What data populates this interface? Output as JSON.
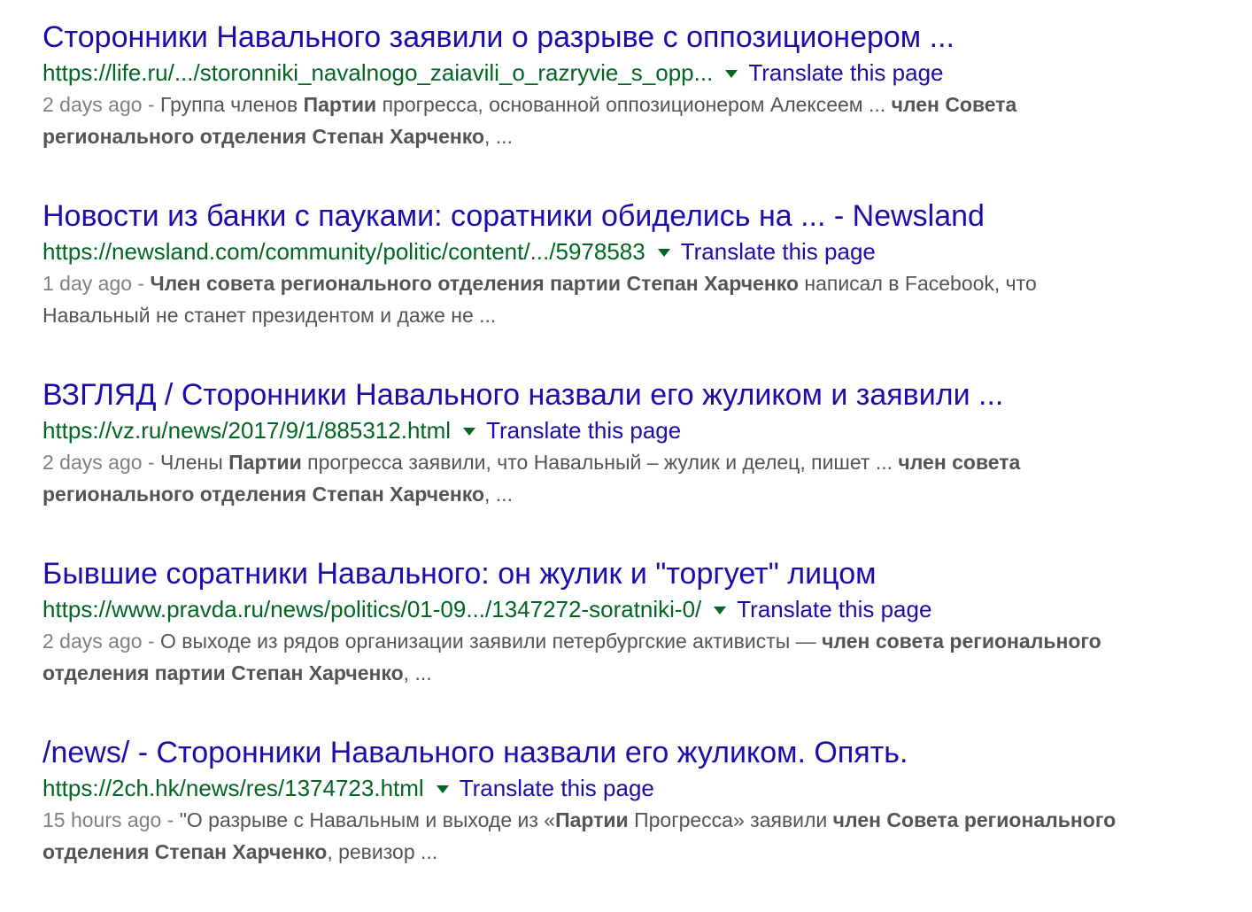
{
  "results": [
    {
      "title": "Сторонники Навального заявили о разрыве с оппозиционером ...",
      "url": "https://life.ru/.../storonniki_navalnogo_zaiavili_o_razryvie_s_opp...",
      "translate": "Translate this page",
      "date": "2 days ago - ",
      "snippet": [
        {
          "text": "Группа членов ",
          "bold": false
        },
        {
          "text": "Партии",
          "bold": true
        },
        {
          "text": " прогресса, основанной оппозиционером Алексеем ... ",
          "bold": false
        },
        {
          "text": "член Совета регионального отделения Степан Харченко",
          "bold": true
        },
        {
          "text": ", ...",
          "bold": false
        }
      ]
    },
    {
      "title": "Новости из банки с пауками: соратники обиделись на ... - Newsland",
      "url": "https://newsland.com/community/politic/content/.../5978583",
      "translate": "Translate this page",
      "date": "1 day ago - ",
      "snippet": [
        {
          "text": "Член совета регионального отделения партии Степан Харченко",
          "bold": true
        },
        {
          "text": " написал в Facebook, что Навальный не станет президентом и даже не ...",
          "bold": false
        }
      ]
    },
    {
      "title": "ВЗГЛЯД / Сторонники Навального назвали его жуликом и заявили ...",
      "url": "https://vz.ru/news/2017/9/1/885312.html",
      "translate": "Translate this page",
      "date": "2 days ago - ",
      "snippet": [
        {
          "text": "Члены ",
          "bold": false
        },
        {
          "text": "Партии",
          "bold": true
        },
        {
          "text": " прогресса заявили, что Навальный – жулик и делец, пишет ... ",
          "bold": false
        },
        {
          "text": "член совета регионального отделения Степан Харченко",
          "bold": true
        },
        {
          "text": ", ...",
          "bold": false
        }
      ]
    },
    {
      "title": "Бывшие соратники Навального: он жулик и \"торгует\" лицом",
      "url": "https://www.pravda.ru/news/politics/01-09.../1347272-soratniki-0/",
      "translate": "Translate this page",
      "date": "2 days ago - ",
      "snippet": [
        {
          "text": "О выходе из рядов организации заявили петербургские активисты — ",
          "bold": false
        },
        {
          "text": "член совета регионального отделения партии Степан Харченко",
          "bold": true
        },
        {
          "text": ", ...",
          "bold": false
        }
      ]
    },
    {
      "title": "/news/ - Сторонники Навального назвали его жуликом. Опять.",
      "url": "https://2ch.hk/news/res/1374723.html",
      "translate": "Translate this page",
      "date": "15 hours ago - ",
      "snippet": [
        {
          "text": "\"О разрыве с Навальным и выходе из «",
          "bold": false
        },
        {
          "text": "Партии",
          "bold": true
        },
        {
          "text": " Прогресса» заявили ",
          "bold": false
        },
        {
          "text": "член Совета регионального отделения Степан Харченко",
          "bold": true
        },
        {
          "text": ", ревизор ...",
          "bold": false
        }
      ]
    }
  ]
}
